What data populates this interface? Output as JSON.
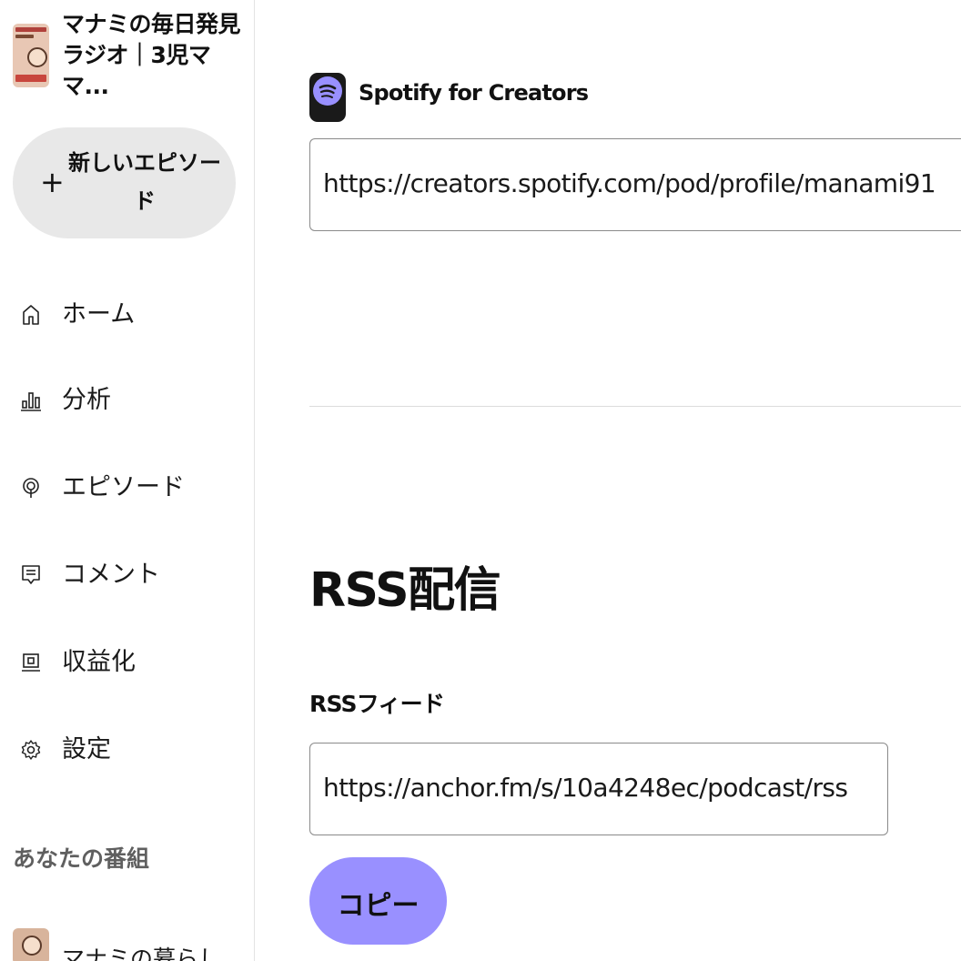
{
  "sidebar": {
    "show_title": "マナミの毎日発見ラジオ｜3児ママ...",
    "new_episode_label": "新しいエピソード",
    "nav": [
      {
        "label": "ホーム",
        "icon": "home-icon"
      },
      {
        "label": "分析",
        "icon": "analytics-icon"
      },
      {
        "label": "エピソード",
        "icon": "episodes-icon"
      },
      {
        "label": "コメント",
        "icon": "comments-icon"
      },
      {
        "label": "収益化",
        "icon": "monetization-icon"
      },
      {
        "label": "設定",
        "icon": "settings-icon"
      }
    ],
    "your_shows_title": "あなたの番組",
    "other_show_name": "マナミの暮らし..."
  },
  "main": {
    "spotify": {
      "name": "Spotify for Creators",
      "url": "https://creators.spotify.com/pod/profile/manami91"
    },
    "rss": {
      "heading": "RSS配信",
      "label": "RSSフィード",
      "url": "https://anchor.fm/s/10a4248ec/podcast/rss",
      "copy_label": "コピー"
    }
  },
  "colors": {
    "accent": "#9990ff",
    "button_gray": "#e8e8e8"
  }
}
